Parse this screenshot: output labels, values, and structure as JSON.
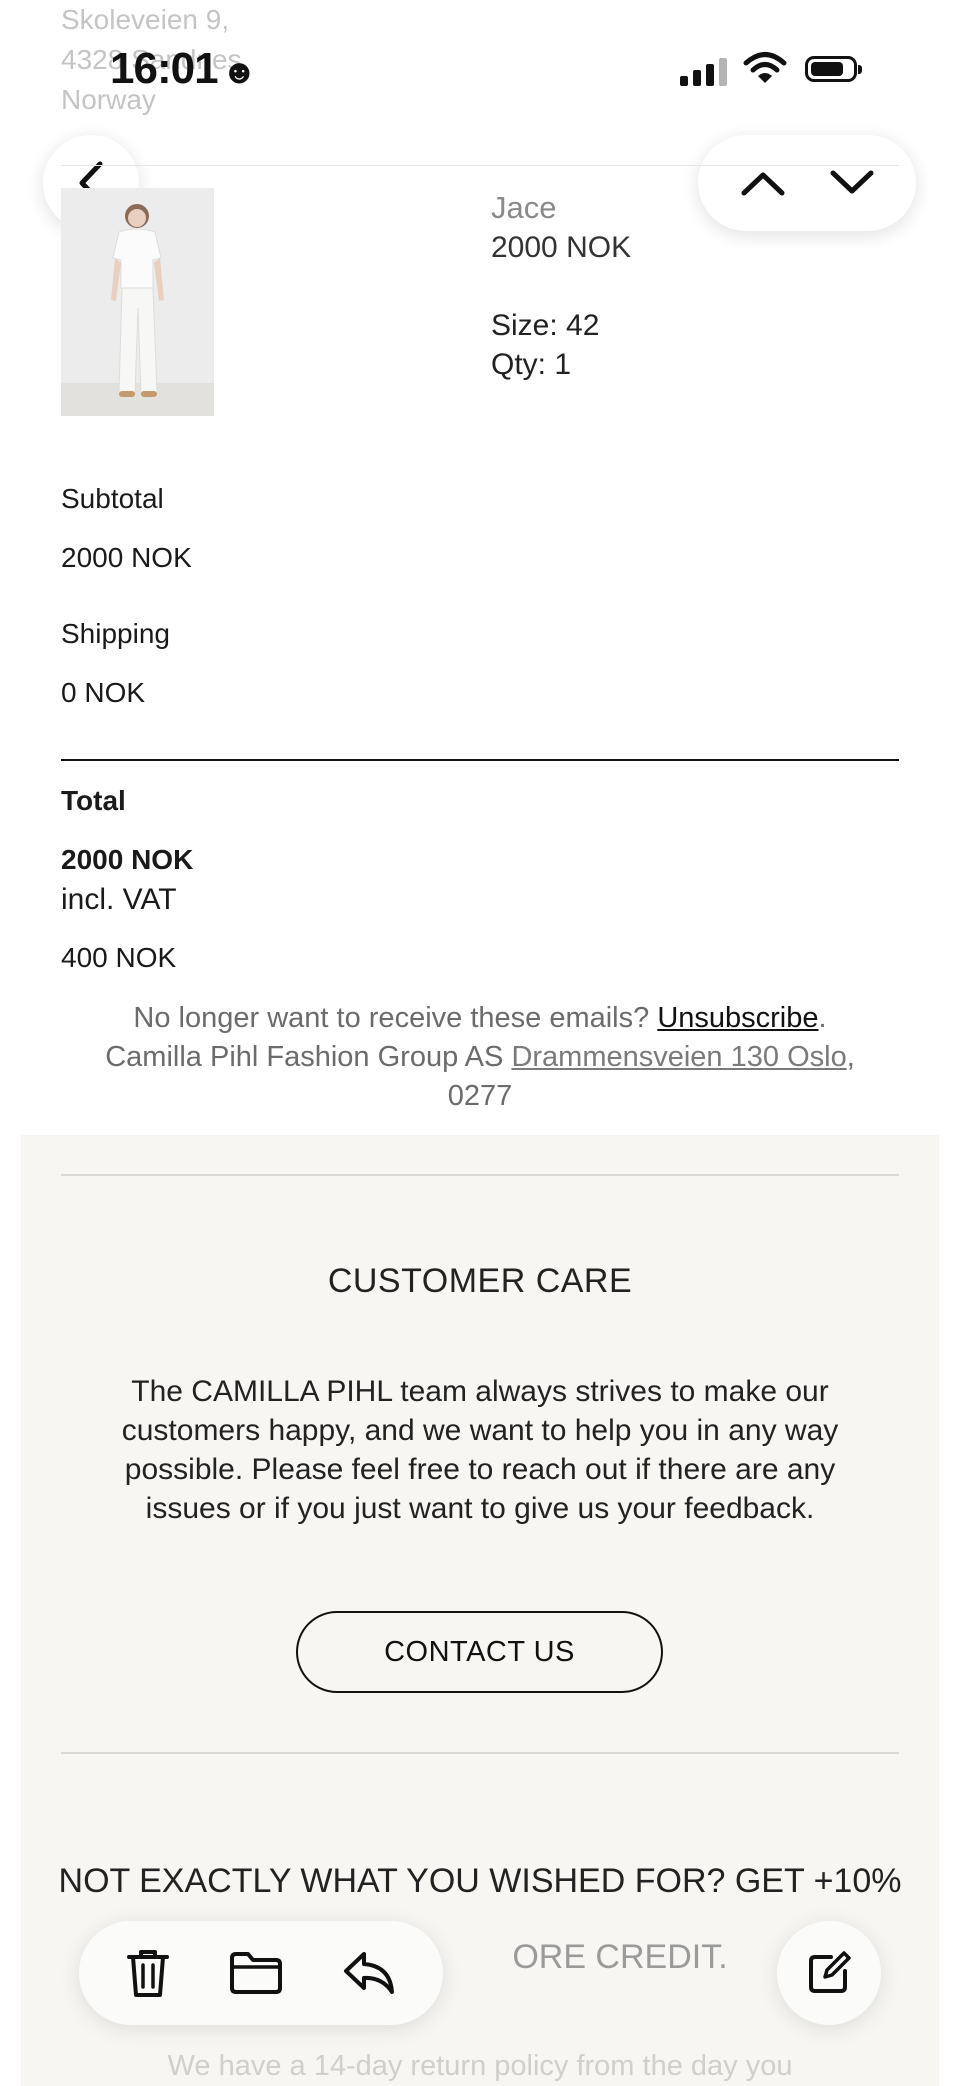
{
  "status_bar": {
    "time": "16:01",
    "time_icon": "☻",
    "icons": [
      "signal-icon",
      "wifi-icon",
      "battery-icon"
    ]
  },
  "header_faded": {
    "address_lines": [
      "Skoleveien 9,",
      "4328 Sandnes,",
      "Norway"
    ]
  },
  "nav": {
    "back_icon": "chevron-left-icon",
    "prev_icon": "chevron-up-icon",
    "next_icon": "chevron-down-icon"
  },
  "order_item": {
    "name": "Jace",
    "price": "2000 NOK",
    "size": "Size: 42",
    "qty": "Qty: 1"
  },
  "summary": {
    "subtotal_label": "Subtotal",
    "subtotal_value": "2000 NOK",
    "shipping_label": "Shipping",
    "shipping_value": "0 NOK",
    "total_label": "Total",
    "total_value": "2000 NOK",
    "vat_label": "incl. VAT",
    "vat_value": "400 NOK"
  },
  "footer": {
    "unsubscribe_prefix": "No longer want to receive these emails?",
    "unsubscribe_link": "Unsubscribe",
    "unsubscribe_suffix": ".",
    "company": "Camilla Pihl Fashion Group AS",
    "address_link": "Drammensveien 130 Oslo",
    "address_suffix": ",",
    "postcode": "0277"
  },
  "customer_care": {
    "title": "CUSTOMER CARE",
    "body": "The CAMILLA PIHL team always strives to make our customers happy, and we want to help you in any way possible. Please feel free to reach out if there are any issues or if you just want to give us your feedback.",
    "button": "CONTACT US"
  },
  "promo": {
    "line1": "NOT EXACTLY WHAT YOU WISHED FOR? GET +10%",
    "line2": "ORE CREDIT."
  },
  "return_policy_partial": "We have a 14-day return policy from the day you",
  "toolbar": {
    "icons": [
      "trash-icon",
      "folder-icon",
      "reply-icon",
      "compose-icon"
    ]
  }
}
